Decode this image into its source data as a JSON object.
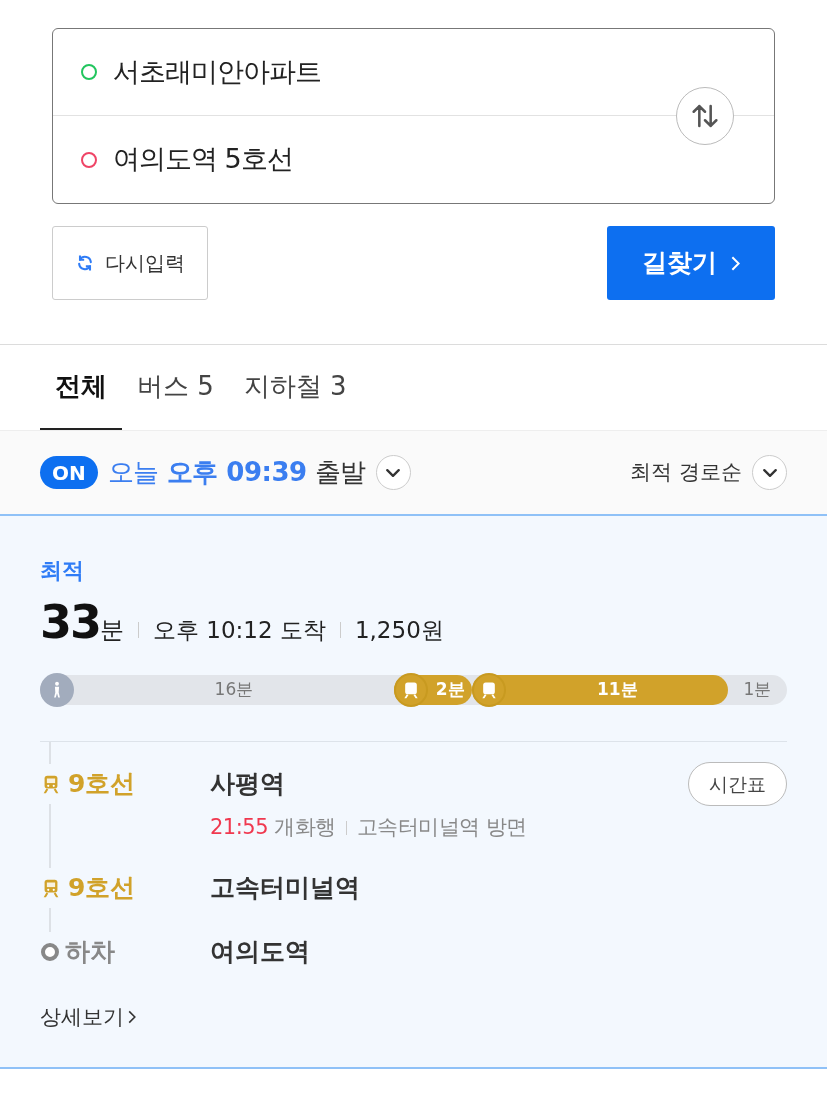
{
  "route_inputs": [
    {
      "kind": "origin",
      "value": "서초래미안아파트"
    },
    {
      "kind": "destination",
      "value": "여의도역 5호선"
    }
  ],
  "reset_button": "다시입력",
  "search_button": "길찾기",
  "tabs": [
    {
      "label": "전체",
      "selected": true
    },
    {
      "label": "버스 5",
      "selected": false
    },
    {
      "label": "지하철 3",
      "selected": false
    }
  ],
  "filter": {
    "toggle": "ON",
    "toggle_on": true,
    "day": "오늘",
    "time": "오후 09:39",
    "suffix": "출발",
    "sort": "최적 경로순"
  },
  "route": {
    "badge": "최적",
    "duration": "33",
    "duration_unit": "분",
    "arrival": "오후 10:12 도착",
    "fare": "1,250원",
    "segments": [
      {
        "kind": "walk",
        "label": "16분"
      },
      {
        "kind": "subway",
        "label": "2분",
        "color": "#d1a22a"
      },
      {
        "kind": "subway",
        "label": "11분",
        "color": "#d1a22a"
      },
      {
        "kind": "walk",
        "label": "1분"
      }
    ],
    "steps": [
      {
        "kind": "board",
        "line": "9호선",
        "color": "#d1a22a",
        "station": "사평역",
        "timetable_button": "시간표",
        "departure_time": "21:55",
        "direction": "개화행",
        "toward": "고속터미널역 방면"
      },
      {
        "kind": "board",
        "line": "9호선",
        "color": "#d1a22a",
        "station": "고속터미널역"
      },
      {
        "kind": "alight",
        "line": "하차",
        "station": "여의도역"
      }
    ],
    "details_link": "상세보기"
  }
}
